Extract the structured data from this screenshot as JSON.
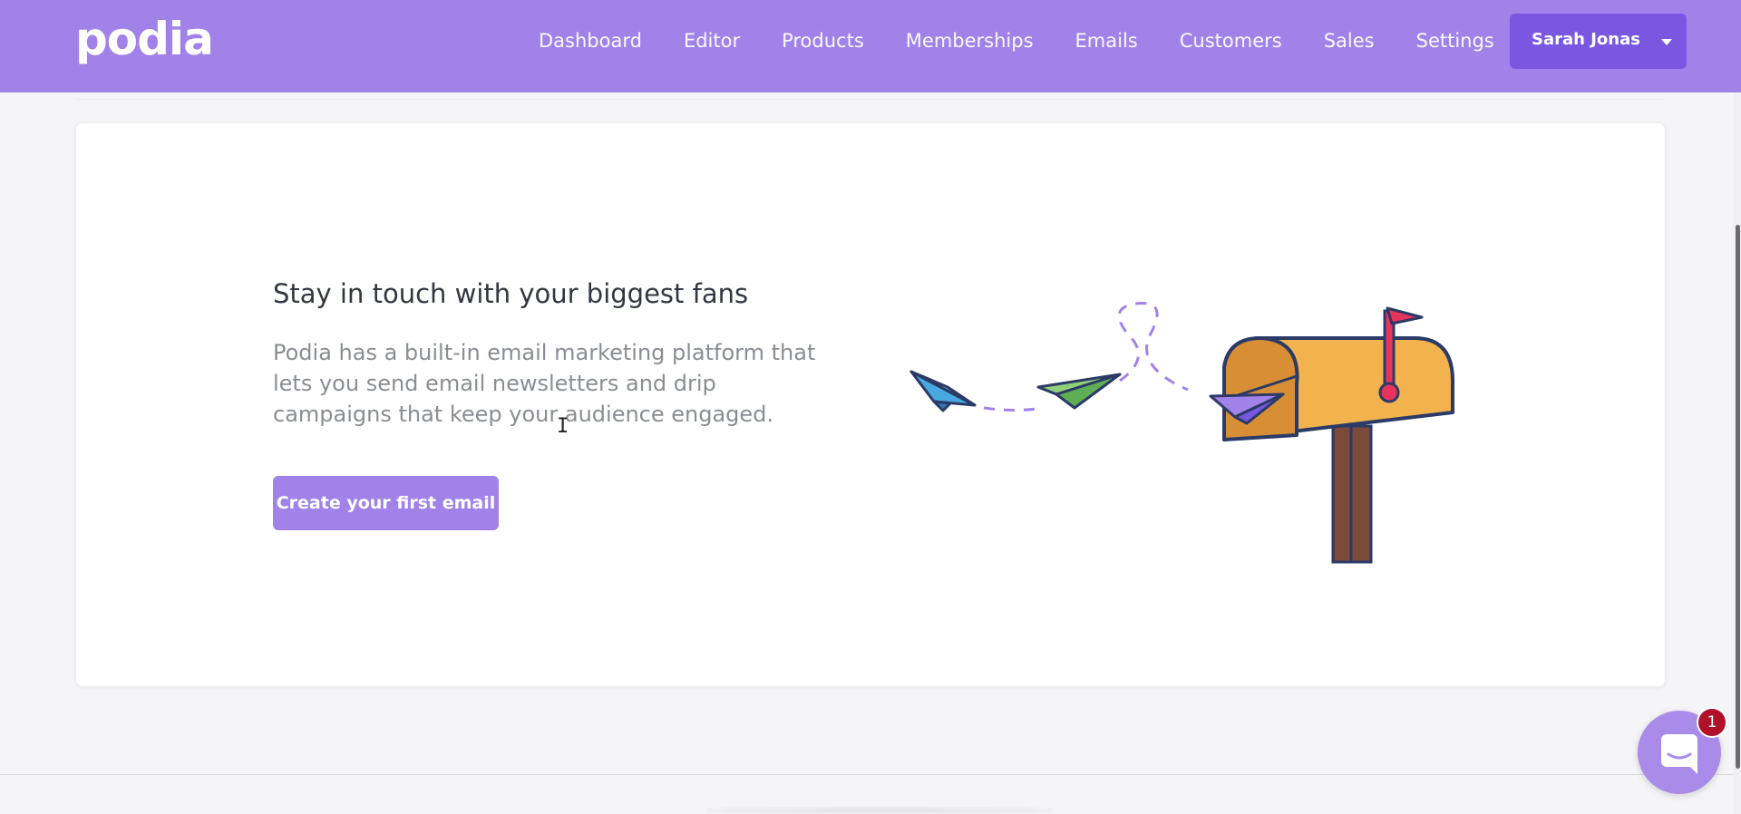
{
  "header": {
    "logo_text": "podia",
    "nav": [
      {
        "label": "Dashboard"
      },
      {
        "label": "Editor"
      },
      {
        "label": "Products"
      },
      {
        "label": "Memberships"
      },
      {
        "label": "Emails"
      },
      {
        "label": "Customers"
      },
      {
        "label": "Sales"
      },
      {
        "label": "Settings"
      }
    ],
    "user_menu_label": "Sarah Jonas"
  },
  "empty_state": {
    "title": "Stay in touch with your biggest fans",
    "description": "Podia has a built-in email marketing platform that lets you send email newsletters and drip campaigns that keep your audience engaged.",
    "cta_label": "Create your first email",
    "illustration": "paper-planes-flying-into-mailbox"
  },
  "chat_widget": {
    "badge_count": "1",
    "icon": "chat-bubble-icon"
  },
  "colors": {
    "brand": "#a182e8",
    "brand_dark": "#7a57e0",
    "background": "#f5f5f8",
    "badge": "#b0102a"
  }
}
